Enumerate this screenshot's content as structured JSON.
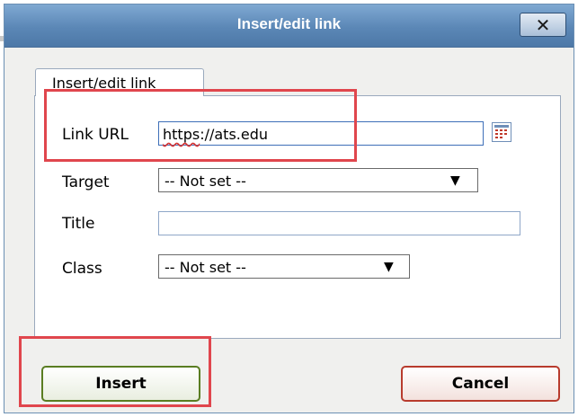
{
  "dialog": {
    "title": "Insert/edit link",
    "close_label": "✕"
  },
  "tab": {
    "label": "Insert/edit link"
  },
  "form": {
    "link_url": {
      "label": "Link URL",
      "value_prefix": "https",
      "value_rest": "://ats.edu"
    },
    "target": {
      "label": "Target",
      "selected": "-- Not set --"
    },
    "title": {
      "label": "Title",
      "value": ""
    },
    "class": {
      "label": "Class",
      "selected": "-- Not set --"
    },
    "dropdown_arrow": "▼"
  },
  "buttons": {
    "insert": "Insert",
    "cancel": "Cancel"
  },
  "colors": {
    "highlight": "#e0464d",
    "titlebar": "#5b87b6"
  },
  "icons": {
    "picker": "link-picker-icon",
    "close": "close-icon"
  }
}
